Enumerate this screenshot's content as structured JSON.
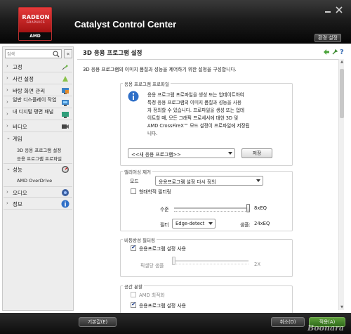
{
  "header": {
    "logo_line1": "RADEON",
    "logo_line2": "GRAPHICS",
    "logo_brand": "AMD",
    "title": "Catalyst Control Center",
    "preset_label": "환경 설정",
    "window_controls": [
      "minimize-icon",
      "close-icon"
    ]
  },
  "sidebar": {
    "search_placeholder": "검색",
    "collapse_label": "«",
    "items": [
      {
        "label": "고정",
        "icon": "pin-icon",
        "expanded": false
      },
      {
        "label": "사전 설정",
        "icon": "preset-icon",
        "expanded": false
      },
      {
        "label": "바탕 화면 관리",
        "icon": "desktop-icon",
        "expanded": false
      },
      {
        "label": "일반 디스플레이 작업",
        "icon": "display-icon",
        "expanded": false
      },
      {
        "label": "내 디지털 평면 패널",
        "icon": "monitor-icon",
        "expanded": false
      },
      {
        "label": "비디오",
        "icon": "video-icon",
        "expanded": false
      },
      {
        "label": "게임",
        "icon": "",
        "expanded": true,
        "children": [
          "3D 응용 프로그램 설정",
          "응용 프로그램 프로파일"
        ]
      },
      {
        "label": "성능",
        "icon": "gauge-icon",
        "expanded": true,
        "children": [
          "AMD OverDrive"
        ]
      },
      {
        "label": "오디오",
        "icon": "audio-icon",
        "expanded": false
      },
      {
        "label": "정보",
        "icon": "info-icon",
        "expanded": false
      }
    ]
  },
  "main": {
    "title": "3D 응용 프로그램 설정",
    "description": "3D 응용 프로그램의 이미지 품질과 성능을 제어하기 위한 설정을 구성합니다.",
    "toolbar_icons": [
      "arrow-left-icon",
      "pin-icon",
      "help-icon"
    ],
    "profile_group": {
      "title": "응용 프로그램 프로파일",
      "info_lines": [
        "응용 프로그램 프로파일을 생성 또는 업데이트하여",
        "특정 응용 프로그램의 이미지 품질과 성능을 사용",
        "자 정의할 수 있습니다. 프로파일을 생성 또는 업데",
        "이트할 때, 모든 그래픽 프로세서에 대한 3D 및",
        "AMD CrossFireX™ 모드 설정이 프로파일에 저장됩",
        "니다."
      ],
      "profile_select": "<<새 응용 프로그램>>",
      "save_label": "저장"
    },
    "aa_group": {
      "title": "앨리어싱 제거",
      "mode_label": "모드",
      "mode_value": "응용프로그램 설정 다시 정의",
      "morph_label": "형태학적 필터링",
      "morph_checked": false,
      "level_label": "수준",
      "level_value": "8xEQ",
      "level_position": 1.0,
      "filter_label": "필터",
      "filter_value": "Edge-detect",
      "samples_label": "샘플:",
      "samples_value": "24xEQ"
    },
    "af_group": {
      "title": "비등방성 필터링",
      "use_app_label": "응용프로그램 설정 사용",
      "use_app_checked": true,
      "sample_label": "픽셀당 샘플",
      "sample_value": "2X",
      "sample_position": 0.0
    },
    "tess_group": {
      "title": "공간 분할",
      "amd_opt_label": "AMD 최적화",
      "amd_opt_checked": false,
      "use_app_label": "응용프로그램 설정 사용",
      "use_app_checked": true
    }
  },
  "footer": {
    "defaults_label": "기본값(E)",
    "cancel_label": "취소(D)",
    "apply_label": "적용(A)",
    "watermark": "Boonara"
  }
}
